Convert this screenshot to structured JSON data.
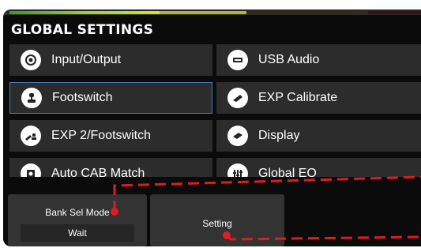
{
  "header": {
    "title": "GLOBAL SETTINGS"
  },
  "menu": {
    "items": [
      {
        "label": "Input/Output",
        "icon": "knob-icon"
      },
      {
        "label": "USB Audio",
        "icon": "usb-icon"
      },
      {
        "label": "Footswitch",
        "icon": "footswitch-icon",
        "selected": true
      },
      {
        "label": "EXP Calibrate",
        "icon": "expression-pedal-icon"
      },
      {
        "label": "EXP 2/Footswitch",
        "icon": "pedal-footswitch-icon"
      },
      {
        "label": "Display",
        "icon": "display-icon"
      },
      {
        "label": "Auto CAB Match",
        "icon": "cab-icon"
      },
      {
        "label": "Global EQ",
        "icon": "eq-icon"
      }
    ]
  },
  "bottom": {
    "bank_sel_mode_label": "Bank Sel Mode",
    "bank_sel_mode_value": "Wait",
    "setting_label": "Setting"
  },
  "colors": {
    "selection_border": "#4a78c2",
    "annotation_red": "#e01b22"
  }
}
